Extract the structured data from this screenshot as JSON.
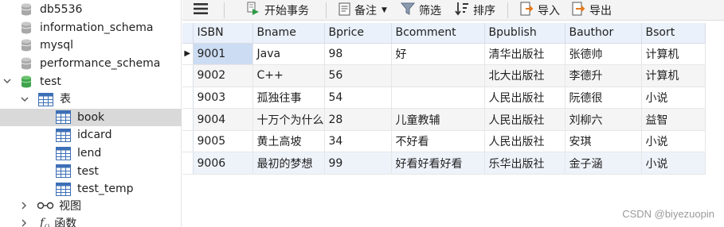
{
  "sidebar": {
    "databases": [
      {
        "label": "db5536"
      },
      {
        "label": "information_schema"
      },
      {
        "label": "mysql"
      },
      {
        "label": "performance_schema"
      },
      {
        "label": "test",
        "expanded": true
      }
    ],
    "tables_group_label": "表",
    "tables": [
      {
        "label": "book",
        "selected": true
      },
      {
        "label": "idcard"
      },
      {
        "label": "lend"
      },
      {
        "label": "test"
      },
      {
        "label": "test_temp"
      }
    ],
    "views_label": "视图",
    "functions_label": "函数"
  },
  "toolbar": {
    "begin_transaction": "开始事务",
    "memo": "备注",
    "filter": "筛选",
    "sort": "排序",
    "import": "导入",
    "export": "导出"
  },
  "grid": {
    "columns": [
      "ISBN",
      "Bname",
      "Bprice",
      "Bcomment",
      "Bpublish",
      "Bauthor",
      "Bsort"
    ],
    "rows": [
      [
        "9001",
        "Java",
        "98",
        "好",
        "清华出版社",
        "张德帅",
        "计算机"
      ],
      [
        "9002",
        "C++",
        "56",
        "",
        "北大出版社",
        "李德升",
        "计算机"
      ],
      [
        "9003",
        "孤独往事",
        "54",
        "",
        "人民出版社",
        "阮德很",
        "小说"
      ],
      [
        "9004",
        "十万个为什么",
        "28",
        "儿童教辅",
        "人民出版社",
        "刘柳六",
        "益智"
      ],
      [
        "9005",
        "黄土高坡",
        "34",
        "不好看",
        "人民出版社",
        "安琪",
        "小说"
      ],
      [
        "9006",
        "最初的梦想",
        "99",
        "好看好看好看",
        "乐华出版社",
        "金子涵",
        "小说"
      ]
    ]
  },
  "watermark": "CSDN @biyezuopin",
  "colors": {
    "db_icon": "#9a9a9a",
    "db_icon_active": "#4caf50",
    "table_icon": "#3d6fb6",
    "header_bg": "#eaf1fb",
    "selected_bg": "#d9d9d9"
  }
}
